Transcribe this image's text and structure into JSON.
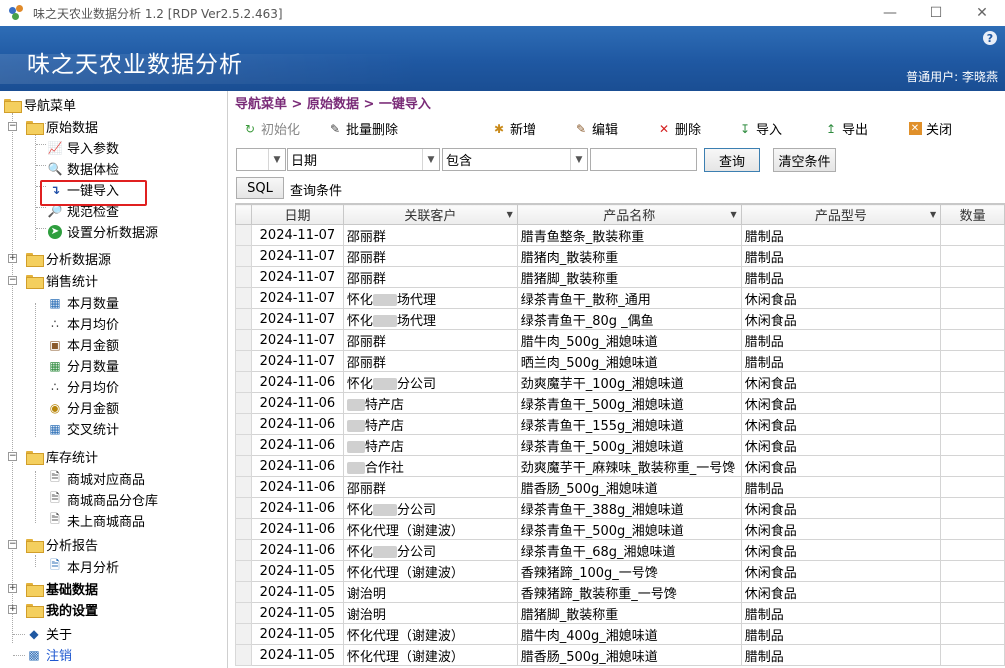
{
  "window": {
    "title": "味之天农业数据分析 1.2 [RDP Ver2.5.2.463]"
  },
  "header": {
    "app_title": "味之天农业数据分析",
    "help": "?",
    "user_label": "普通用户: 李晓燕"
  },
  "sidebar": {
    "root": "导航菜单",
    "raw_data": "原始数据",
    "import_params": "导入参数",
    "data_check": "数据体检",
    "one_key_import": "一键导入",
    "norm_check": "规范检查",
    "set_source": "设置分析数据源",
    "analysis_source": "分析数据源",
    "sales_stats": "销售统计",
    "month_qty": "本月数量",
    "month_avg": "本月均价",
    "month_amount": "本月金额",
    "split_month_qty": "分月数量",
    "split_month_avg": "分月均价",
    "split_month_amount": "分月金额",
    "cross_stats": "交叉统计",
    "stock_stats": "库存统计",
    "mall_products": "商城对应商品",
    "mall_warehouse": "商城商品分仓库",
    "not_listed": "未上商城商品",
    "analysis_report": "分析报告",
    "month_analysis": "本月分析",
    "base_data": "基础数据",
    "my_settings": "我的设置",
    "about": "关于",
    "logout": "注销"
  },
  "breadcrumb": "导航菜单 > 原始数据 > 一键导入",
  "toolbar": {
    "init": "初始化",
    "batch_delete": "批量删除",
    "add": "新增",
    "edit": "编辑",
    "delete": "删除",
    "import": "导入",
    "export": "导出",
    "close": "关闭"
  },
  "filter": {
    "field": "日期",
    "operator": "包含",
    "value": "",
    "query": "查询",
    "clear": "清空条件",
    "sql": "SQL",
    "condition_label": "查询条件"
  },
  "grid": {
    "columns": [
      "日期",
      "关联客户",
      "产品名称",
      "产品型号",
      "数量"
    ],
    "rows": [
      {
        "date": "2024-11-07",
        "customer": "邵丽群",
        "product": "腊青鱼整条_散装称重",
        "model": "腊制品"
      },
      {
        "date": "2024-11-07",
        "customer": "邵丽群",
        "product": "腊猪肉_散装称重",
        "model": "腊制品"
      },
      {
        "date": "2024-11-07",
        "customer": "邵丽群",
        "product": "腊猪脚_散装称重",
        "model": "腊制品"
      },
      {
        "date": "2024-11-07",
        "customer": "怀化",
        "customer_tail": "场代理",
        "product": "绿茶青鱼干_散称_通用",
        "model": "休闲食品"
      },
      {
        "date": "2024-11-07",
        "customer": "怀化",
        "customer_tail": "场代理",
        "product": "绿茶青鱼干_80g _偶鱼",
        "model": "休闲食品"
      },
      {
        "date": "2024-11-07",
        "customer": "邵丽群",
        "product": "腊牛肉_500g_湘媳味道",
        "model": "腊制品"
      },
      {
        "date": "2024-11-07",
        "customer": "邵丽群",
        "product": "晒兰肉_500g_湘媳味道",
        "model": "腊制品"
      },
      {
        "date": "2024-11-06",
        "customer": "怀化",
        "customer_tail": "分公司",
        "product": "劲爽魔芋干_100g_湘媳味道",
        "model": "休闲食品"
      },
      {
        "date": "2024-11-06",
        "customer": "",
        "customer_tail": "特产店",
        "product": "绿茶青鱼干_500g_湘媳味道",
        "model": "休闲食品"
      },
      {
        "date": "2024-11-06",
        "customer": "",
        "customer_tail": "特产店",
        "product": "绿茶青鱼干_155g_湘媳味道",
        "model": "休闲食品"
      },
      {
        "date": "2024-11-06",
        "customer": "",
        "customer_tail": "特产店",
        "product": "绿茶青鱼干_500g_湘媳味道",
        "model": "休闲食品"
      },
      {
        "date": "2024-11-06",
        "customer": "",
        "customer_tail": "合作社",
        "product": "劲爽魔芋干_麻辣味_散装称重_一号馋",
        "model": "休闲食品"
      },
      {
        "date": "2024-11-06",
        "customer": "邵丽群",
        "product": "腊香肠_500g_湘媳味道",
        "model": "腊制品"
      },
      {
        "date": "2024-11-06",
        "customer": "怀化",
        "customer_tail": "分公司",
        "product": "绿茶青鱼干_388g_湘媳味道",
        "model": "休闲食品"
      },
      {
        "date": "2024-11-06",
        "customer": "怀化代理（谢建波）",
        "product": "绿茶青鱼干_500g_湘媳味道",
        "model": "休闲食品"
      },
      {
        "date": "2024-11-06",
        "customer": "怀化",
        "customer_tail": "分公司",
        "product": "绿茶青鱼干_68g_湘媳味道",
        "model": "休闲食品"
      },
      {
        "date": "2024-11-05",
        "customer": "怀化代理（谢建波）",
        "product": "香辣猪蹄_100g_一号馋",
        "model": "休闲食品"
      },
      {
        "date": "2024-11-05",
        "customer": "谢治明",
        "product": "香辣猪蹄_散装称重_一号馋",
        "model": "休闲食品"
      },
      {
        "date": "2024-11-05",
        "customer": "谢治明",
        "product": "腊猪脚_散装称重",
        "model": "腊制品"
      },
      {
        "date": "2024-11-05",
        "customer": "怀化代理（谢建波）",
        "product": "腊牛肉_400g_湘媳味道",
        "model": "腊制品"
      },
      {
        "date": "2024-11-05",
        "customer": "怀化代理（谢建波）",
        "product": "腊香肠_500g_湘媳味道",
        "model": "腊制品"
      }
    ]
  }
}
